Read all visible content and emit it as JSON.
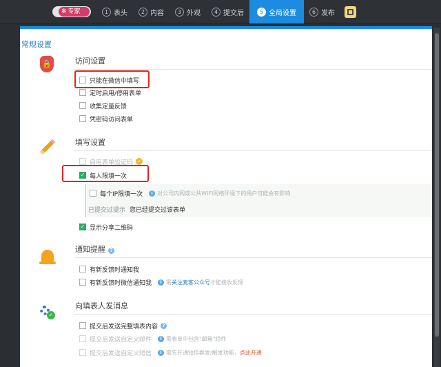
{
  "topbar": {
    "mode_label": "专家",
    "steps": [
      {
        "num": "1",
        "label": "表头"
      },
      {
        "num": "2",
        "label": "内容"
      },
      {
        "num": "3",
        "label": "外观"
      },
      {
        "num": "4",
        "label": "提交后"
      },
      {
        "num": "5",
        "label": "全局设置"
      },
      {
        "num": "6",
        "label": "发布"
      }
    ],
    "active_step": 5
  },
  "panel": {
    "section_title": "常规设置",
    "access": {
      "title": "访问设置",
      "options": [
        {
          "label": "只能在微信中填写",
          "checked": false
        },
        {
          "label": "定时启用/停用表单",
          "checked": false
        },
        {
          "label": "收集定量反馈",
          "checked": false
        },
        {
          "label": "凭密码访问表单",
          "checked": false
        }
      ]
    },
    "fill": {
      "title": "填写设置",
      "captcha_label": "启用表单验证码",
      "once_per_person_label": "每人限填一次",
      "once_per_ip_label": "每个IP限填一次",
      "once_per_ip_hint": "对公司内网或公共WIFI网络环境下的用户可能会有影响",
      "submitted_key": "已提交过提示",
      "submitted_value": "您已经提交过该表单",
      "share_qr_label": "显示分享二维码"
    },
    "notify": {
      "title": "通知提醒",
      "options": [
        {
          "label": "有新反馈时通知我"
        },
        {
          "label": "有新反馈时微信通知我"
        }
      ],
      "wechat_hint_pre": "需",
      "wechat_hint_link": "关注麦客公众号",
      "wechat_hint_post": "才能接收反馈"
    },
    "message": {
      "title": "向填表人发消息",
      "send_full_label": "提交后发送完整填表内容",
      "send_mail_label": "提交后发送自定义邮件",
      "send_mail_hint": "需表单中包含\"邮箱\"组件",
      "send_sms_label": "提交后发送自定义短信",
      "send_sms_hint_pre": "需先开通短信群发/触发功能，",
      "send_sms_hint_link": "点此开通"
    }
  },
  "icons": {
    "access": "shield-lock-icon",
    "fill": "pencil-icon",
    "notify": "bell-icon",
    "message": "gears-icon"
  },
  "colors": {
    "accent": "#1d8ce0",
    "highlight_border": "#e4231f",
    "checked": "#27ae60"
  }
}
